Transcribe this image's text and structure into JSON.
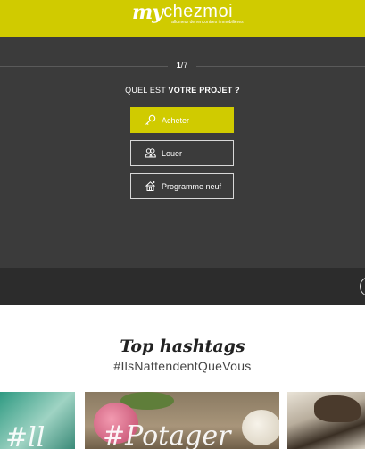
{
  "header": {
    "logo_my": "my",
    "logo_brand": "chezmoi",
    "logo_tagline": "allumeur de rencontres immobilières",
    "background_color": "#d0cb00"
  },
  "wizard": {
    "step_current": "1",
    "step_separator": "/",
    "step_total": "7",
    "question_prefix": "QUEL EST ",
    "question_emphasis": "VOTRE PROJET ?",
    "options": [
      {
        "label": "Acheter",
        "icon": "key-icon",
        "selected": true
      },
      {
        "label": "Louer",
        "icon": "people-icon",
        "selected": false
      },
      {
        "label": "Programme neuf",
        "icon": "house-icon",
        "selected": false
      }
    ]
  },
  "hashtags": {
    "title": "Top hashtags",
    "subtitle": "#IlsNattendentQueVous",
    "tiles": [
      {
        "text": "#ll"
      },
      {
        "text": "#Potager"
      },
      {
        "text": ""
      }
    ]
  }
}
